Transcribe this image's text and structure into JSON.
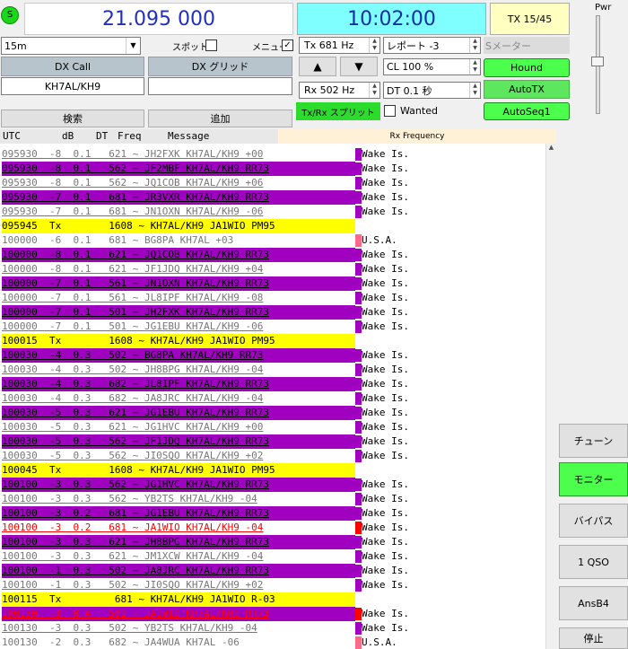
{
  "top": {
    "status_icon": "S",
    "frequency": "21.095 000",
    "clock": "10:02:00",
    "tx_counter": "TX 15/45",
    "band": "15m",
    "spot_label": "スポット",
    "menu_label": "メニュー",
    "tx_offset": "Tx  681 Hz",
    "report": "レポート -3",
    "s_meter": "Sメーター",
    "dx_call_label": "DX Call",
    "dx_grid_label": "DX グリッド",
    "dx_call_value": "KH7AL/KH9",
    "dx_grid_value": "",
    "cl": "CL  100 %",
    "hound": "Hound",
    "rx_offset": "Rx  502 Hz",
    "dt": "DT 0.1 秒",
    "autotx": "AutoTX",
    "split": "Tx/Rx スプリット",
    "wanted": "Wanted",
    "autoseq": "AutoSeq1",
    "search": "検索",
    "add": "追加",
    "pwr": "Pwr"
  },
  "table": {
    "col_utc": "UTC",
    "col_db": "dB",
    "col_dt": "DT",
    "col_freq": "Freq",
    "col_msg": "Message",
    "col_rx": "Rx Frequency"
  },
  "rows": [
    {
      "text": "095930  -8  0.1   621 ~ JH2FXK KH7AL/KH9 +00",
      "rx": "Wake Is.",
      "type": "w"
    },
    {
      "text": "095930  -8  0.1   562 ~ JF2MBF KH7AL/KH9 RR73",
      "rx": "Wake Is.",
      "type": "m"
    },
    {
      "text": "095930  -8  0.1   562 ~ JQ1COB KH7AL/KH9 +06",
      "rx": "Wake Is.",
      "type": "w"
    },
    {
      "text": "095930  -7  0.1   681 ~ JR3VXR KH7AL/KH9 RR73",
      "rx": "Wake Is.",
      "type": "m"
    },
    {
      "text": "095930  -7  0.1   681 ~ JN1OXN KH7AL/KH9 -06",
      "rx": "Wake Is.",
      "type": "w"
    },
    {
      "text": "095945  Tx        1608 ~ KH7AL/KH9 JA1WIO PM95",
      "rx": "",
      "type": "y"
    },
    {
      "text": "100000  -6  0.1   681 ~ BG8PA KH7AL +03",
      "rx": "U.S.A.",
      "type": "w2"
    },
    {
      "text": "100000  -8  0.1   621 ~ JQ1COB KH7AL/KH9 RR73",
      "rx": "Wake Is.",
      "type": "m"
    },
    {
      "text": "100000  -8  0.1   621 ~ JF1JDQ KH7AL/KH9 +04",
      "rx": "Wake Is.",
      "type": "w"
    },
    {
      "text": "100000  -7  0.1   561 ~ JN1OXN KH7AL/KH9 RR73",
      "rx": "Wake Is.",
      "type": "m"
    },
    {
      "text": "100000  -7  0.1   561 ~ JL8IPF KH7AL/KH9 -08",
      "rx": "Wake Is.",
      "type": "w"
    },
    {
      "text": "100000  -7  0.1   501 ~ JH2FXK KH7AL/KH9 RR73",
      "rx": "Wake Is.",
      "type": "m"
    },
    {
      "text": "100000  -7  0.1   501 ~ JG1EBU KH7AL/KH9 -06",
      "rx": "Wake Is.",
      "type": "w"
    },
    {
      "text": "100015  Tx        1608 ~ KH7AL/KH9 JA1WIO PM95",
      "rx": "",
      "type": "y"
    },
    {
      "text": "100030  -4  0.3   502 ~ BG8PA KH7AL/KH9 RR73",
      "rx": "Wake Is.",
      "type": "m"
    },
    {
      "text": "100030  -4  0.3   502 ~ JH8BPG KH7AL/KH9 -04",
      "rx": "Wake Is.",
      "type": "w"
    },
    {
      "text": "100030  -4  0.3   682 ~ JL8IPF KH7AL/KH9 RR73",
      "rx": "Wake Is.",
      "type": "m"
    },
    {
      "text": "100030  -4  0.3   682 ~ JA8JRC KH7AL/KH9 -04",
      "rx": "Wake Is.",
      "type": "w"
    },
    {
      "text": "100030  -5  0.3   621 ~ JG1EBU KH7AL/KH9 RR73",
      "rx": "Wake Is.",
      "type": "m"
    },
    {
      "text": "100030  -5  0.3   621 ~ JG1HVC KH7AL/KH9 +00",
      "rx": "Wake Is.",
      "type": "w"
    },
    {
      "text": "100030  -5  0.3   562 ~ JF1JDQ KH7AL/KH9 RR73",
      "rx": "Wake Is.",
      "type": "m"
    },
    {
      "text": "100030  -5  0.3   562 ~ JI0SQO KH7AL/KH9 +02",
      "rx": "Wake Is.",
      "type": "w"
    },
    {
      "text": "100045  Tx        1608 ~ KH7AL/KH9 JA1WIO PM95",
      "rx": "",
      "type": "y"
    },
    {
      "text": "100100  -3  0.3   562 ~ JG1HVC KH7AL/KH9 RR73",
      "rx": "Wake Is.",
      "type": "m"
    },
    {
      "text": "100100  -3  0.3   562 ~ YB2TS KH7AL/KH9 -04",
      "rx": "Wake Is.",
      "type": "w"
    },
    {
      "text": "100100  -3  0.2   681 ~ JG1EBU KH7AL/KH9 RR73",
      "rx": "Wake Is.",
      "type": "m"
    },
    {
      "text": "100100  -3  0.2   681 ~ JA1WIO KH7AL/KH9 -04",
      "rx": "Wake Is.",
      "type": "r"
    },
    {
      "text": "100100  -3  0.3   621 ~ JH8BPG KH7AL/KH9 RR73",
      "rx": "Wake Is.",
      "type": "m"
    },
    {
      "text": "100100  -3  0.3   621 ~ JM1XCW KH7AL/KH9 -04",
      "rx": "Wake Is.",
      "type": "w"
    },
    {
      "text": "100100  -1  0.3   502 ~ JA8JRC KH7AL/KH9 RR73",
      "rx": "Wake Is.",
      "type": "m"
    },
    {
      "text": "100100  -1  0.3   502 ~ JI0SQO KH7AL/KH9 +02",
      "rx": "Wake Is.",
      "type": "w"
    },
    {
      "text": "100115  Tx         681 ~ KH7AL/KH9 JA1WIO R-03",
      "rx": "",
      "type": "y"
    },
    {
      "text": "100130  -3  0.4   502 ~ JA1WIO KH7AL/KH9 RR73",
      "rx": "Wake Is.",
      "type": "r2"
    },
    {
      "text": "100130  -3  0.3   502 ~ YB2TS KH7AL/KH9 -04",
      "rx": "Wake Is.",
      "type": "w"
    },
    {
      "text": "100130  -2  0.3   682 ~ JA4WUA KH7AL -06",
      "rx": "U.S.A.",
      "type": "w2"
    }
  ],
  "side_buttons": [
    "チューン",
    "モニター",
    "バイパス",
    "1 QSO",
    "AnsB4",
    "停止"
  ],
  "colors": {
    "magenta": "#a000c0",
    "yellow": "#ffff00",
    "red": "#ff0000",
    "green": "#4cff4c",
    "cyan": "#7fffff",
    "pink": "#ff6a8a"
  }
}
